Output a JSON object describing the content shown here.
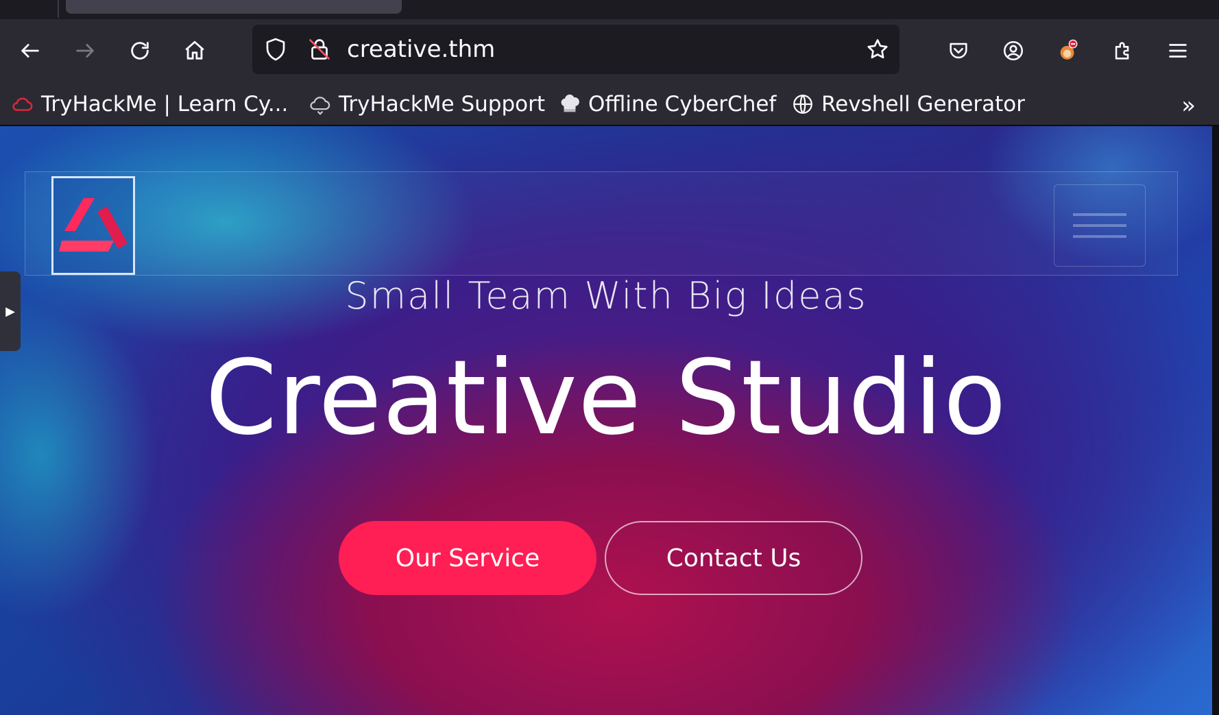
{
  "browser": {
    "url": "creative.thm",
    "bookmarks": [
      {
        "label": "TryHackMe | Learn Cy...",
        "icon": "tryhackme-cloud-icon"
      },
      {
        "label": "TryHackMe Support",
        "icon": "cloud-support-icon"
      },
      {
        "label": "Offline CyberChef",
        "icon": "chef-hat-icon"
      },
      {
        "label": "Revshell Generator",
        "icon": "globe-icon"
      }
    ],
    "more_label": "»"
  },
  "page": {
    "tagline": "Small Team With Big Ideas",
    "title": "Creative Studio",
    "buttons": {
      "primary": "Our Service",
      "secondary": "Contact Us"
    }
  },
  "colors": {
    "accent": "#ff1f55",
    "chrome": "#2b2a33",
    "urlbar": "#1c1b22"
  }
}
